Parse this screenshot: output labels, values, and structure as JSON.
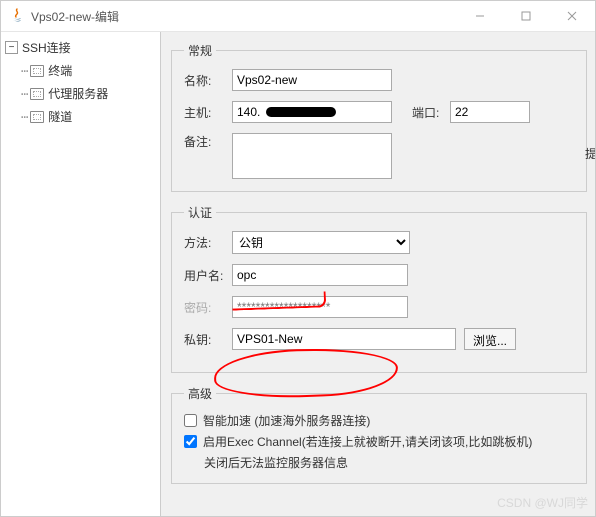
{
  "window": {
    "title": "Vps02-new-编辑"
  },
  "sidebar": {
    "root": "SSH连接",
    "items": [
      {
        "label": "终端"
      },
      {
        "label": "代理服务器"
      },
      {
        "label": "隧道"
      }
    ]
  },
  "general": {
    "legend": "常规",
    "name_label": "名称:",
    "name_value": "Vps02-new",
    "host_label": "主机:",
    "host_prefix": "140.",
    "port_label": "端口:",
    "port_value": "22",
    "notes_label": "备注:",
    "notes_value": ""
  },
  "auth": {
    "legend": "认证",
    "method_label": "方法:",
    "method_value": "公钥",
    "user_label": "用户名:",
    "user_value": "opc",
    "pass_label": "密码:",
    "pass_placeholder": "********************",
    "key_label": "私钥:",
    "key_value": "VPS01-New",
    "browse_label": "浏览..."
  },
  "advanced": {
    "legend": "高级",
    "accel_label": "智能加速 (加速海外服务器连接)",
    "accel_checked": false,
    "exec_label": "启用Exec Channel(若连接上就被断开,请关闭该项,比如跳板机)",
    "exec_checked": true,
    "exec_hint": "关闭后无法监控服务器信息"
  },
  "edge_text": "提",
  "watermark": "CSDN @WJ同学"
}
